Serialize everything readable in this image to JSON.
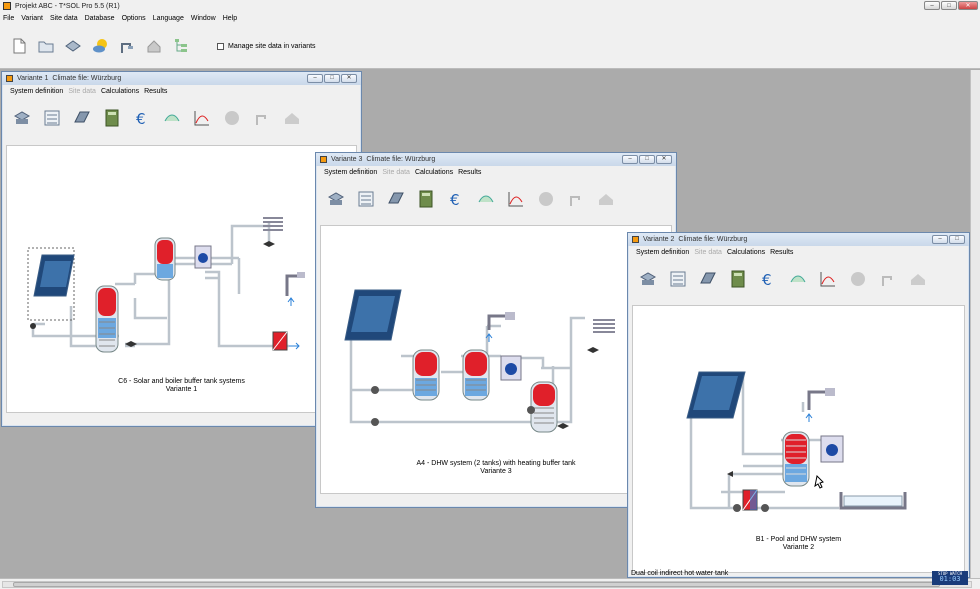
{
  "app": {
    "title": "Projekt ABC - T*SOL Pro 5.5 (R1)"
  },
  "window_buttons": {
    "minimize": "–",
    "restore": "□",
    "close": "✕"
  },
  "menu": [
    "File",
    "Variant",
    "Site data",
    "Database",
    "Options",
    "Language",
    "Window",
    "Help"
  ],
  "toolbar": {
    "icons": [
      "new-document-icon",
      "open-folder-icon",
      "save-icon",
      "weather-icon",
      "shower-icon",
      "house-icon",
      "tree-icon"
    ],
    "checkbox_label": "Manage site data in variants"
  },
  "child_menu": {
    "system": "System definition",
    "site": "Site data",
    "calc": "Calculations",
    "results": "Results"
  },
  "windows": [
    {
      "title": "Variante 1",
      "climate": "Climate file: Würzburg",
      "caption1": "C6 - Solar and boiler buffer tank systems",
      "caption2": "Variante 1"
    },
    {
      "title": "Variante 3",
      "climate": "Climate file: Würzburg",
      "caption1": "A4 - DHW system (2 tanks) with heating buffer tank",
      "caption2": "Variante 3"
    },
    {
      "title": "Variante 2",
      "climate": "Climate file: Würzburg",
      "caption1": "B1 - Pool and DHW system",
      "caption2": "Variante 2"
    }
  ],
  "status": {
    "description": "Dual coil indirect hot water tank",
    "clock_label": "STOP WATCH",
    "clock_value": "01:03"
  },
  "colors": {
    "accent": "#f59a10",
    "title_gradient": "#c9d8ea",
    "tank_hot": "#e0202a",
    "tank_cold": "#2a80d8"
  }
}
